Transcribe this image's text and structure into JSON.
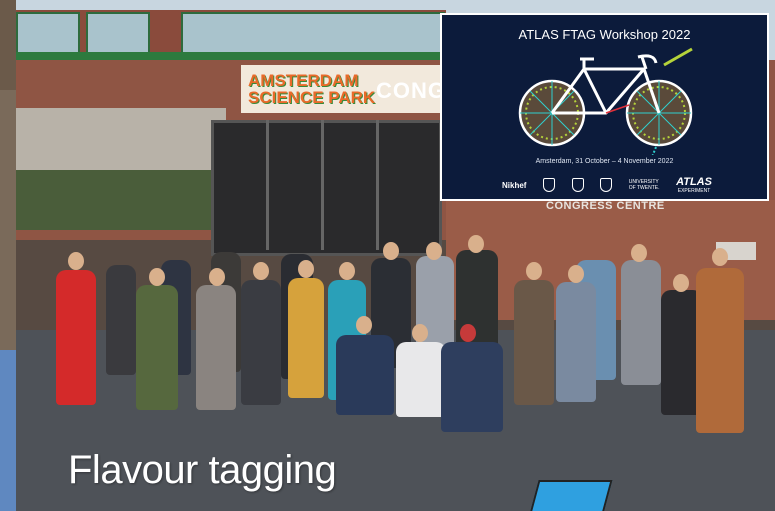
{
  "left_strip": {
    "color": "#4d7bb0"
  },
  "photo": {
    "description_tag": "group-photo",
    "building_sign_1": "AMSTERDAM",
    "building_sign_2": "SCIENCE PARK",
    "building_sign_3": "CONG",
    "congress_centre": "CONGRESS CENTRE"
  },
  "poster": {
    "title": "ATLAS FTAG Workshop 2022",
    "subtitle": "Amsterdam, 31 October – 4 November 2022",
    "logos": {
      "nikhef": "Nikhef",
      "twente_line1": "UNIVERSITY",
      "twente_line2": "OF TWENTE.",
      "atlas": "ATLAS",
      "atlas_sub": "EXPERIMENT"
    },
    "colors": {
      "background": "#0c1b3b",
      "accent_green": "#b5d33a",
      "accent_cyan": "#2fd0d0",
      "accent_red": "#e0303a"
    }
  },
  "caption": {
    "text": "Flavour tagging"
  }
}
